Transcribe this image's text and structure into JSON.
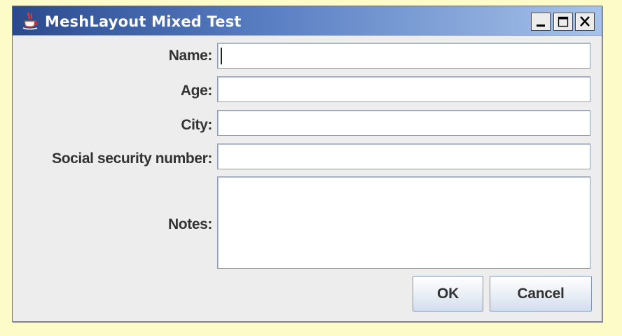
{
  "window": {
    "title": "MeshLayout Mixed Test",
    "controls": {
      "minimize": "minimize-icon",
      "maximize": "maximize-icon",
      "close": "close-icon"
    }
  },
  "form": {
    "fields": [
      {
        "label": "Name:",
        "value": ""
      },
      {
        "label": "Age:",
        "value": ""
      },
      {
        "label": "City:",
        "value": ""
      },
      {
        "label": "Social security number:",
        "value": ""
      },
      {
        "label": "Notes:",
        "value": ""
      }
    ]
  },
  "buttons": {
    "ok": "OK",
    "cancel": "Cancel"
  },
  "colors": {
    "desktop_background": "#fdfbc8",
    "titlebar_start": "#2a4a8e",
    "titlebar_end": "#a7c3ea",
    "window_background": "#ededed"
  }
}
